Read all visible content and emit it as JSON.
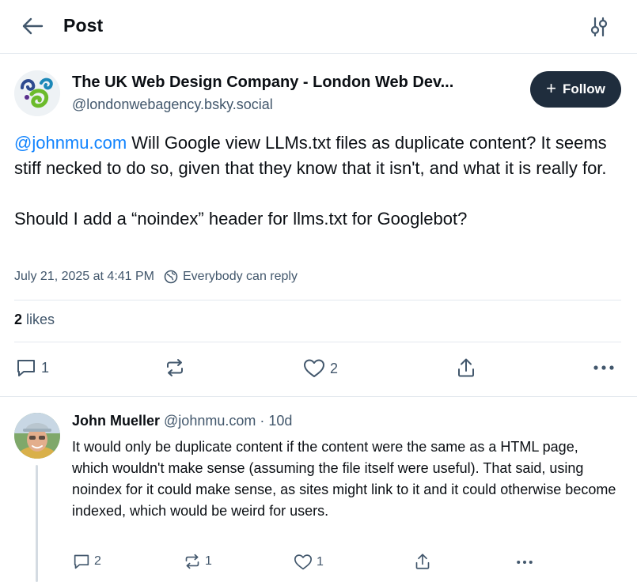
{
  "header": {
    "title": "Post",
    "back_icon": "arrow-left-icon",
    "settings_icon": "sliders-icon"
  },
  "post": {
    "author_name": "The UK Web Design Company - London Web Dev...",
    "author_handle": "@londonwebagency.bsky.social",
    "follow_label": "Follow",
    "mention": "@johnmu.com",
    "text_rest": " Will Google view LLMs.txt files as duplicate content? It seems stiff necked to do so, given that they know that it isn't, and what it is really for.",
    "text_second": "Should I add a “noindex” header for llms.txt for Googlebot?",
    "timestamp": "July 21, 2025 at 4:41 PM",
    "reply_setting": "Everybody can reply",
    "likes_count": "2",
    "likes_label": "likes",
    "actions": {
      "reply_count": "1",
      "repost_count": "",
      "like_count": "2"
    }
  },
  "reply": {
    "author_name": "John Mueller",
    "author_handle": "@johnmu.com",
    "separator": "·",
    "time": "10d",
    "text": "It would only be duplicate content if the content were the same as a HTML page, which wouldn't make sense (assuming the file itself were useful). That said, using noindex for it could make sense, as sites might link to it and it could otherwise become indexed, which would be weird for users.",
    "actions": {
      "reply_count": "2",
      "repost_count": "1",
      "like_count": "1"
    }
  },
  "colors": {
    "link": "#1083fe",
    "muted": "#42576c",
    "follow_bg": "#1f2d3d",
    "border": "#e3e8ee"
  }
}
